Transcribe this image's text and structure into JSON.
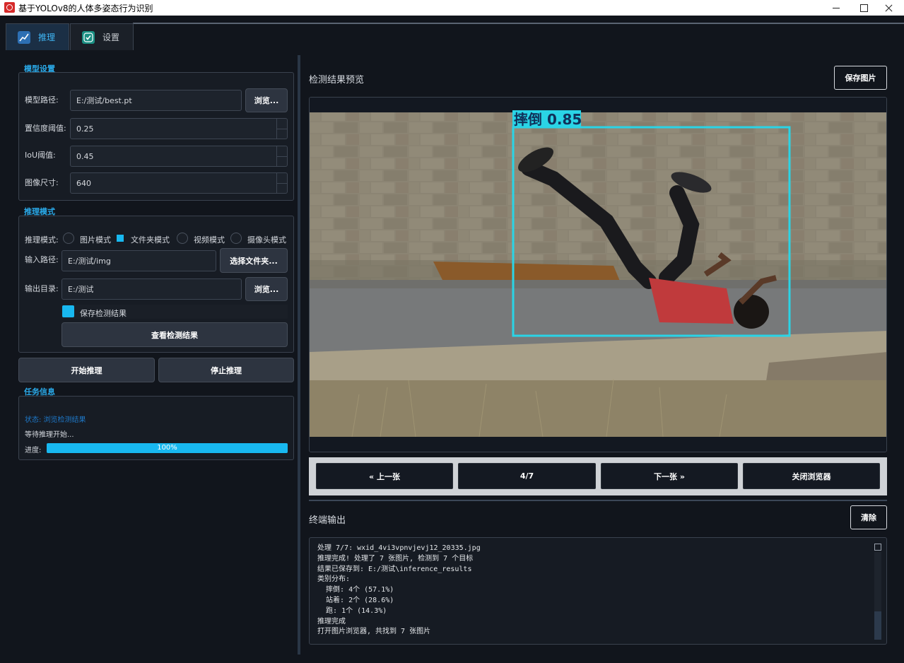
{
  "window": {
    "title": "基于YOLOv8的人体多姿态行为识别"
  },
  "tabs": [
    {
      "label": "推理",
      "icon": "chart-icon",
      "active": true
    },
    {
      "label": "设置",
      "icon": "checkmark-icon",
      "active": false
    }
  ],
  "model_settings": {
    "title": "模型设置",
    "path_label": "模型路径:",
    "path_value": "E:/测试/best.pt",
    "browse_label": "浏览...",
    "conf_label": "置信度阈值:",
    "conf_value": "0.25",
    "iou_label": "IoU阈值:",
    "iou_value": "0.45",
    "imgsz_label": "图像尺寸:",
    "imgsz_value": "640"
  },
  "inference_mode": {
    "title": "推理模式",
    "mode_label": "推理模式:",
    "options": [
      "图片模式",
      "文件夹模式",
      "视频模式",
      "摄像头模式"
    ],
    "selected": "文件夹模式",
    "input_label": "输入路径:",
    "input_value": "E:/测试/img",
    "select_folder_label": "选择文件夹...",
    "output_label": "输出目录:",
    "output_value": "E:/测试",
    "output_browse_label": "浏览...",
    "save_results_label": "保存检测结果",
    "save_results_checked": true,
    "view_results_label": "查看检测结果"
  },
  "actions": {
    "start_label": "开始推理",
    "stop_label": "停止推理"
  },
  "task_info": {
    "title": "任务信息",
    "status": "状态: 浏览检测结果",
    "message": "等待推理开始...",
    "progress_label": "进度:",
    "progress_value": 1.0,
    "progress_text": "100%"
  },
  "preview": {
    "title": "检测结果预览",
    "save_label": "保存图片",
    "detection_label": "摔倒 0.85",
    "nav": {
      "prev": "« 上一张",
      "counter": "4/7",
      "next": "下一张 »",
      "close": "关闭浏览器"
    }
  },
  "terminal": {
    "title": "终端输出",
    "clear_label": "清除",
    "lines": [
      "处理 7/7: wxid_4vi3vpnvjevj12_20335.jpg",
      "推理完成! 处理了 7 张图片, 检测到 7 个目标",
      "结果已保存到: E:/测试\\inference_results",
      "类别分布:",
      "  摔倒: 4个 (57.1%)",
      "  站着: 2个 (28.6%)",
      "  跑: 1个 (14.3%)",
      "推理完成",
      "打开图片浏览器, 共找到 7 张图片"
    ]
  },
  "colors": {
    "accent": "#18b8f0",
    "bbox": "#2ad4e6",
    "background": "#11151c"
  }
}
